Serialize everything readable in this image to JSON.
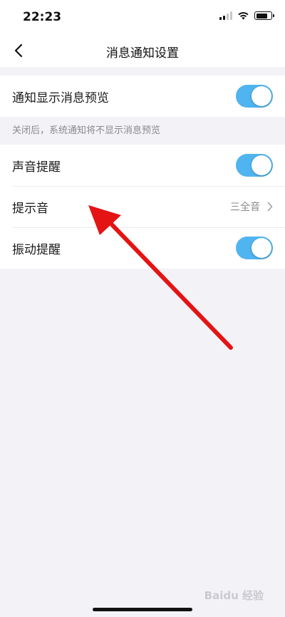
{
  "status_bar": {
    "time": "22:23"
  },
  "nav": {
    "title": "消息通知设置",
    "back_icon": "chevron-left-icon"
  },
  "preview_section": {
    "label": "通知显示消息预览",
    "toggle_on": true,
    "hint": "关闭后，系统通知将不显示消息预览"
  },
  "settings": [
    {
      "label": "声音提醒",
      "type": "toggle",
      "on": true
    },
    {
      "label": "提示音",
      "type": "link",
      "value": "三全音"
    },
    {
      "label": "振动提醒",
      "type": "toggle",
      "on": true
    }
  ],
  "colors": {
    "accent": "#4fb4ef",
    "arrow": "#e41414",
    "background": "#f3f3f7"
  },
  "watermark": "Baidu 经验"
}
